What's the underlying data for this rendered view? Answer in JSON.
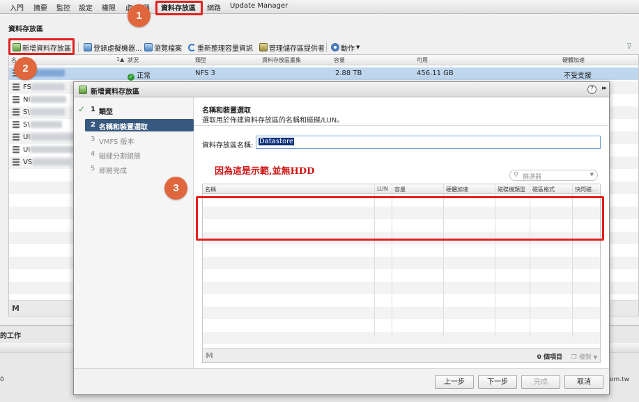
{
  "top_tabs": [
    {
      "label": "入門",
      "active": false
    },
    {
      "label": "摘要",
      "active": false
    },
    {
      "label": "監控",
      "active": false
    },
    {
      "label": "設定",
      "active": false
    },
    {
      "label": "權限",
      "active": false
    },
    {
      "label": "虛",
      "active": false
    },
    {
      "label": "器",
      "active": false
    },
    {
      "label": "資料存放區",
      "active": true
    },
    {
      "label": "網路",
      "active": false
    },
    {
      "label": "Update Manager",
      "active": false
    }
  ],
  "main": {
    "title": "資料存放區",
    "toolbar": {
      "new_datastore": "新增資料存放區",
      "register_vm": "登錄虛擬機器...",
      "browse_files": "瀏覽檔案",
      "refresh_capacity": "重新整理容量資訊",
      "manage_providers": "管理儲存區提供者",
      "actions": "動作"
    },
    "columns": [
      "名",
      "狀況",
      "類型",
      "資料存放區叢集",
      "容量",
      "可用",
      "硬體加速"
    ],
    "sort_indicator": "1▲",
    "rows": [
      {
        "name": "",
        "status": "正常",
        "type": "NFS 3",
        "cluster": "",
        "capacity": "2.88 TB",
        "free": "456.11 GB",
        "hw_accel": "不受支援",
        "selected": true
      },
      {
        "name": "FS",
        "status": "",
        "type": "",
        "cluster": "",
        "capacity": "",
        "free": "",
        "hw_accel": ""
      },
      {
        "name": "NI",
        "status": "",
        "type": "",
        "cluster": "",
        "capacity": "",
        "free": "",
        "hw_accel": ""
      },
      {
        "name": "S\\",
        "status": "",
        "type": "",
        "cluster": "",
        "capacity": "",
        "free": "",
        "hw_accel": ""
      },
      {
        "name": "S\\",
        "status": "",
        "type": "",
        "cluster": "",
        "capacity": "",
        "free": "",
        "hw_accel": ""
      },
      {
        "name": "UI",
        "status": "",
        "type": "",
        "cluster": "",
        "capacity": "",
        "free": "",
        "hw_accel": ""
      },
      {
        "name": "UI",
        "status": "",
        "type": "",
        "cluster": "",
        "capacity": "",
        "free": "",
        "hw_accel": ""
      },
      {
        "name": "VS",
        "status": "",
        "type": "",
        "cluster": "",
        "capacity": "",
        "free": "",
        "hw_accel": ""
      }
    ],
    "find_icon": "M"
  },
  "tasks": {
    "title": "的工作",
    "left_glyph": "0",
    "right_text": "om.tw"
  },
  "dialog": {
    "title": "新增資料存放區",
    "help": "?",
    "expand": "▸▸",
    "steps": [
      {
        "num": "1",
        "label": "類型",
        "state": "done"
      },
      {
        "num": "2",
        "label": "名稱和裝置選取",
        "state": "current"
      },
      {
        "num": "3",
        "label": "VMFS 版本",
        "state": "pending"
      },
      {
        "num": "4",
        "label": "磁碟分割組態",
        "state": "pending"
      },
      {
        "num": "5",
        "label": "即將完成",
        "state": "pending"
      }
    ],
    "section_title": "名稱和裝置選取",
    "section_desc": "選取用於佈建資料存放區的名稱和磁碟/LUN。",
    "name_label": "資料存放區名稱:",
    "name_value": "Datastore",
    "filter_placeholder": "篩選器",
    "disk_columns": [
      "名稱",
      "LUN",
      "容量",
      "硬體加速",
      "磁碟機類型",
      "磁區格式",
      "快閃磁..."
    ],
    "footer_count": "0 個項目",
    "copy_label": "複製",
    "find_icon": "M",
    "note": "因為這是示範,並無HDD",
    "buttons": {
      "back": "上一步",
      "next": "下一步",
      "finish": "完成",
      "cancel": "取消"
    }
  },
  "annotations": {
    "callout_1": "1",
    "callout_2": "2",
    "callout_3": "3"
  },
  "colors": {
    "callout": "#e0673d",
    "highlight_box": "#e0201f",
    "current_step": "#37597f",
    "note_text": "#d01515"
  }
}
